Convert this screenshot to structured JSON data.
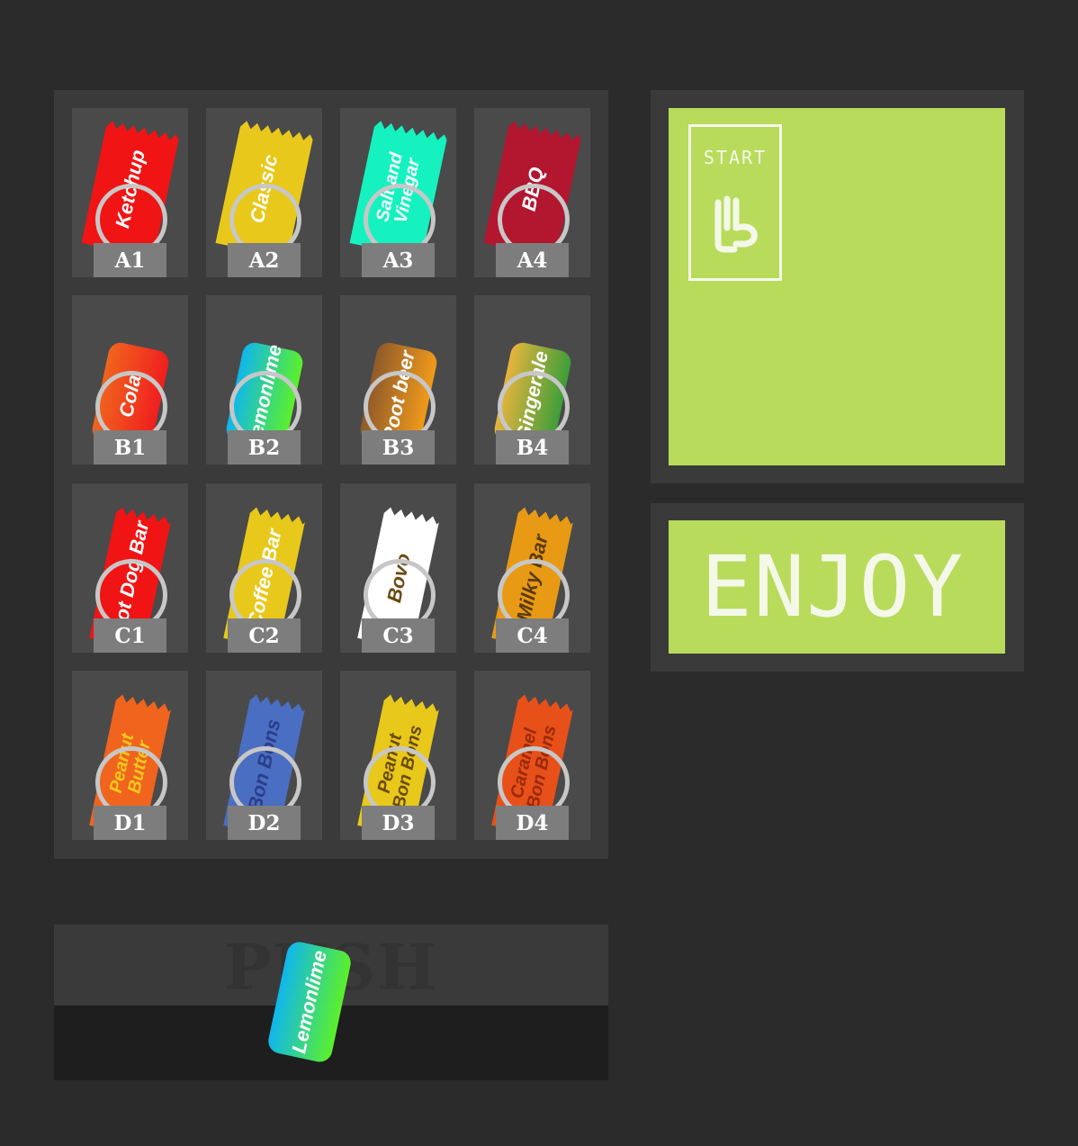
{
  "colors": {
    "machine_bg": "#2b2b2b",
    "panel": "#3a3a3a",
    "slot": "#4a4a4a",
    "code_tag": "#7d7d7d",
    "lcd_green": "#b8db5c",
    "lcd_text": "#f4f8e8",
    "tray": "#1e1e1e"
  },
  "slots": [
    {
      "code": "A1",
      "name": "Ketchup",
      "kind": "chip",
      "bg": "#f01414",
      "fg": "#ffffff"
    },
    {
      "code": "A2",
      "name": "Classic",
      "kind": "chip",
      "bg": "#e8c81a",
      "fg": "#ffffff"
    },
    {
      "code": "A3",
      "name": "Salt and\nVinegar",
      "kind": "chip",
      "bg": "#15f2c0",
      "fg": "#ffffff"
    },
    {
      "code": "A4",
      "name": "BBQ",
      "kind": "chip",
      "bg": "#b3162f",
      "fg": "#ffffff"
    },
    {
      "code": "B1",
      "name": "Cola",
      "kind": "can",
      "bg": "linear-gradient(90deg,#f0641e,#f01e1e)",
      "fg": "#ffffff"
    },
    {
      "code": "B2",
      "name": "Lemonlime",
      "kind": "can",
      "bg": "linear-gradient(90deg,#0fb6ee,#5cf02a)",
      "fg": "#ffffff"
    },
    {
      "code": "B3",
      "name": "Root beer",
      "kind": "can",
      "bg": "linear-gradient(90deg,#8f5a2a,#f09a1a)",
      "fg": "#ffffff"
    },
    {
      "code": "B4",
      "name": "Gingerale",
      "kind": "can",
      "bg": "linear-gradient(90deg,#e6b43c,#3d9e3a)",
      "fg": "#ffffff"
    },
    {
      "code": "C1",
      "name": "Hot Dog Bar",
      "kind": "bar",
      "bg": "#f01414",
      "fg": "#ffffff"
    },
    {
      "code": "C2",
      "name": "Coffee Bar",
      "kind": "bar",
      "bg": "#e8c81a",
      "fg": "#ffffff"
    },
    {
      "code": "C3",
      "name": "Bovo",
      "kind": "bar",
      "bg": "#ffffff",
      "fg": "#6b4a12"
    },
    {
      "code": "C4",
      "name": "Milky Bar",
      "kind": "bar",
      "bg": "#e89a14",
      "fg": "#5a3a0a"
    },
    {
      "code": "D1",
      "name": "Peanut\nButter",
      "kind": "bar",
      "bg": "#f0641e",
      "fg": "#f0c81e"
    },
    {
      "code": "D2",
      "name": "Bon Bons",
      "kind": "bar",
      "bg": "#4a6ec2",
      "fg": "#2a3e8a"
    },
    {
      "code": "D3",
      "name": "Peanut\nBon Bons",
      "kind": "bar",
      "bg": "#e8c81a",
      "fg": "#6b4a0a"
    },
    {
      "code": "D4",
      "name": "Caramel\nBon Bons",
      "kind": "bar",
      "bg": "#e8501a",
      "fg": "#9a2a0a"
    }
  ],
  "push_door": {
    "label": "PUSH"
  },
  "dropped_item": {
    "name": "Lemonlime"
  },
  "start_button": {
    "label": "START",
    "icon": "hand-pointer-icon"
  },
  "display": {
    "text": "ENJOY"
  }
}
